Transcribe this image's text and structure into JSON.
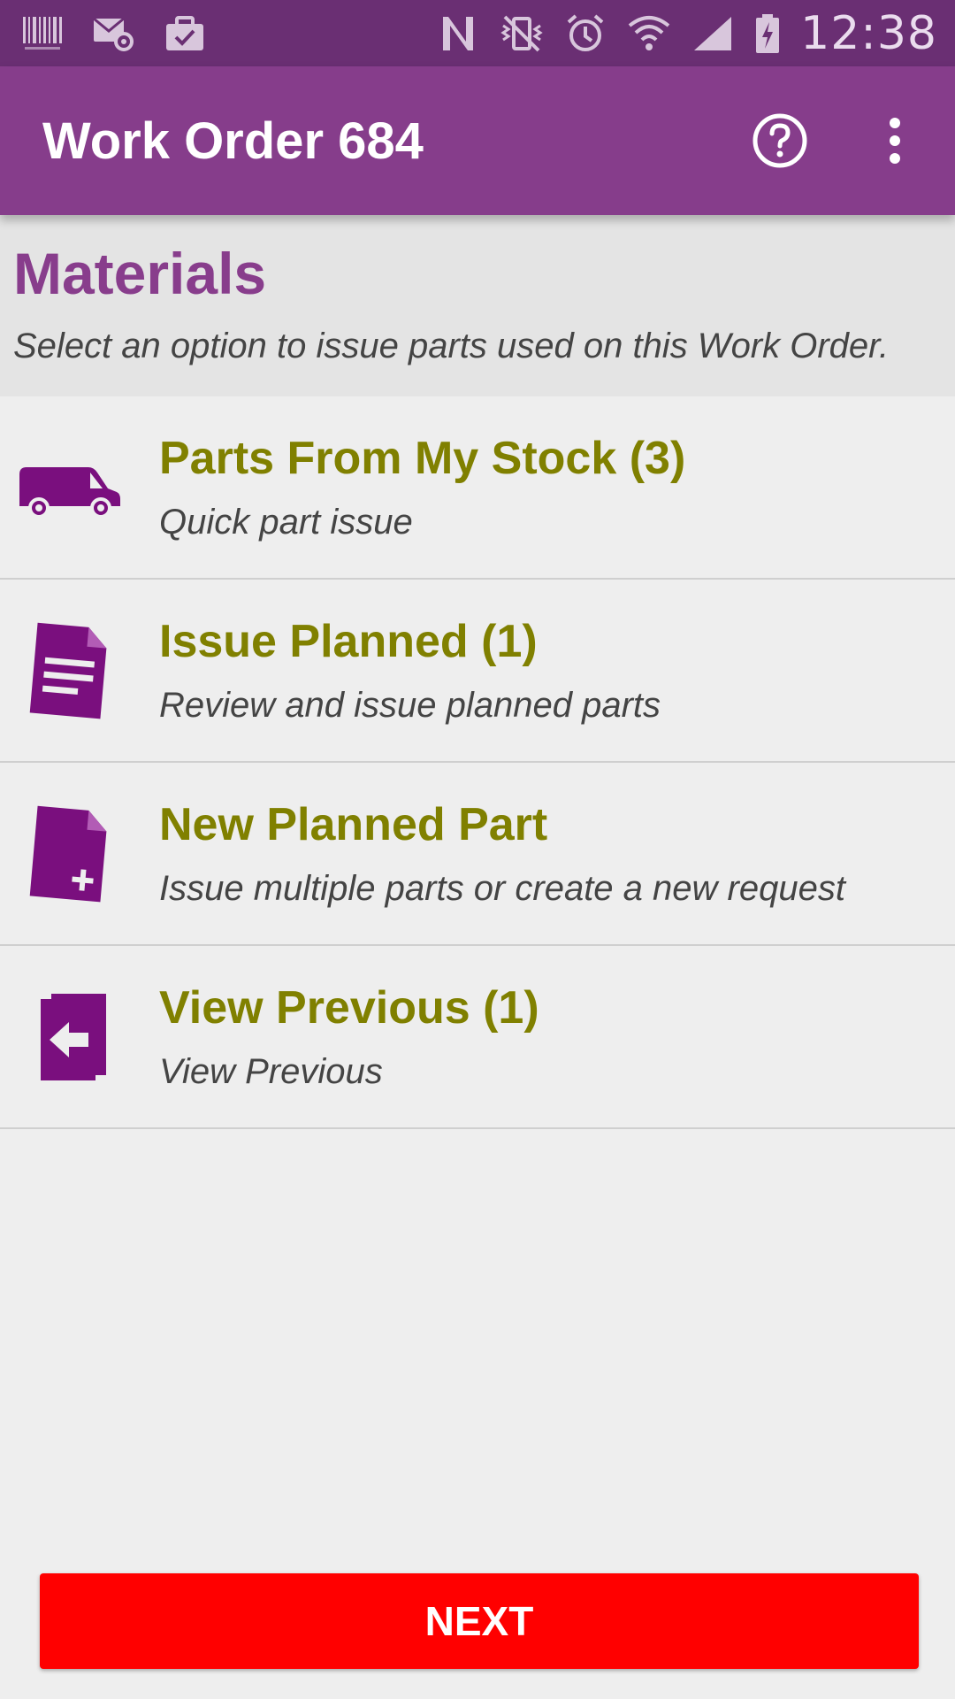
{
  "status_bar": {
    "time": "12:38",
    "left_icons": [
      "barcode-icon",
      "mail-settings-icon",
      "briefcase-check-icon"
    ],
    "right_icons": [
      "nfc-icon",
      "vibrate-icon",
      "alarm-icon",
      "wifi-icon",
      "signal-icon",
      "battery-charging-icon"
    ]
  },
  "appbar": {
    "title": "Work Order 684",
    "actions": [
      "help-icon",
      "overflow-menu-icon"
    ]
  },
  "header": {
    "title": "Materials",
    "subtitle": "Select an option to issue parts used on this Work Order."
  },
  "list": [
    {
      "icon": "van-icon",
      "title": "Parts From My Stock (3)",
      "subtitle": "Quick part issue"
    },
    {
      "icon": "document-lines-icon",
      "title": "Issue Planned (1)",
      "subtitle": "Review and issue planned parts"
    },
    {
      "icon": "document-add-icon",
      "title": "New Planned Part",
      "subtitle": "Issue multiple parts or create a new request"
    },
    {
      "icon": "documents-back-icon",
      "title": "View Previous (1)",
      "subtitle": "View Previous"
    }
  ],
  "next_button": {
    "label": "NEXT"
  },
  "colors": {
    "status_bar": "#6a2f73",
    "app_bar": "#863d8b",
    "header_bg": "#e4e4e4",
    "page_bg": "#eeeeee",
    "heading_purple": "#883d8c",
    "item_title_olive": "#808000",
    "icon_purple": "#7a0f7e",
    "next_button": "#ff0000"
  }
}
